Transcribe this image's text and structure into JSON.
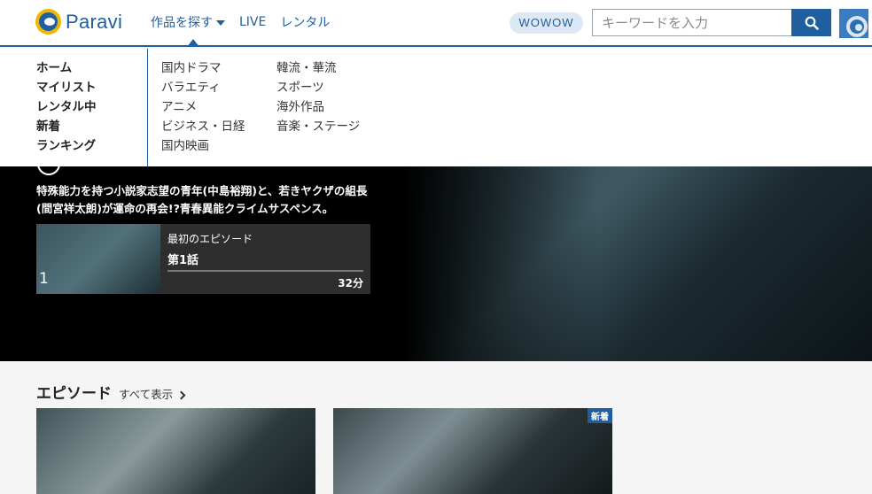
{
  "brand": {
    "name": "Paravi"
  },
  "nav": {
    "items": [
      "作品を探す",
      "LIVE",
      "レンタル"
    ]
  },
  "wowow_label": "WOWOW",
  "search": {
    "placeholder": "キーワードを入力"
  },
  "menu": {
    "primary": [
      "ホーム",
      "マイリスト",
      "レンタル中",
      "新着",
      "ランキング"
    ],
    "genres_col1": [
      "国内ドラマ",
      "バラエティ",
      "アニメ",
      "ビジネス・日経",
      "国内映画"
    ],
    "genres_col2": [
      "韓流・華流",
      "スポーツ",
      "海外作品",
      "音楽・ステージ"
    ]
  },
  "hero": {
    "description": "特殊能力を持つ小説家志望の青年(中島裕翔)と、若きヤクザの組長(間宮祥太朗)が運命の再会!?青春異能クライムサスペンス。",
    "episode": {
      "label": "最初のエピソード",
      "title": "第1話",
      "number": "1",
      "duration": "32分"
    }
  },
  "episodes_section": {
    "title": "エピソード",
    "show_all": "すべて表示",
    "new_badge": "新着"
  },
  "colors": {
    "accent": "#1f5fa0",
    "logo_ring": "#f2b600"
  }
}
